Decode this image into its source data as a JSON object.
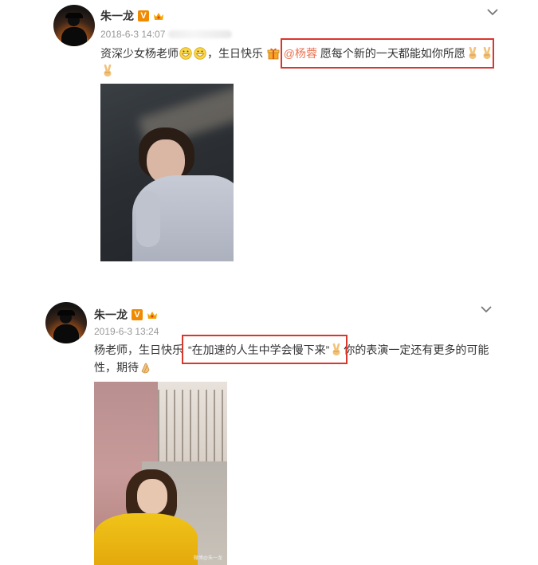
{
  "posts": [
    {
      "username": "朱一龙",
      "vip_badge": "V",
      "timestamp": "2018-6-3 14:07",
      "text_line1_before": "资深少女杨老师",
      "text_line1_mid": "，生日快乐 ",
      "mention": "@杨蓉",
      "text_line1_after": " 愿每个新的一天都能如你所愿",
      "emojis": [
        "grin-emoji",
        "grin-emoji",
        "gift-emoji",
        "victory-hand-emoji",
        "victory-hand-emoji",
        "victory-hand-emoji"
      ]
    },
    {
      "username": "朱一龙",
      "vip_badge": "V",
      "timestamp": "2019-6-3 13:24",
      "text_line1_a": "杨老师，生日快乐",
      "text_line1_quote": "“在加速的人生中学会慢下来”",
      "text_line1_b": "你的表演一定还有更多的可能",
      "text_line2": "性，期待",
      "photo_watermark": "微博@朱一龙",
      "emojis": [
        "victory-hand-emoji",
        "clapping-hands-emoji"
      ]
    }
  ],
  "colors": {
    "mention": "#eb7350",
    "highlight_box": "#d9362c",
    "vip_badge": "#f08a00"
  }
}
